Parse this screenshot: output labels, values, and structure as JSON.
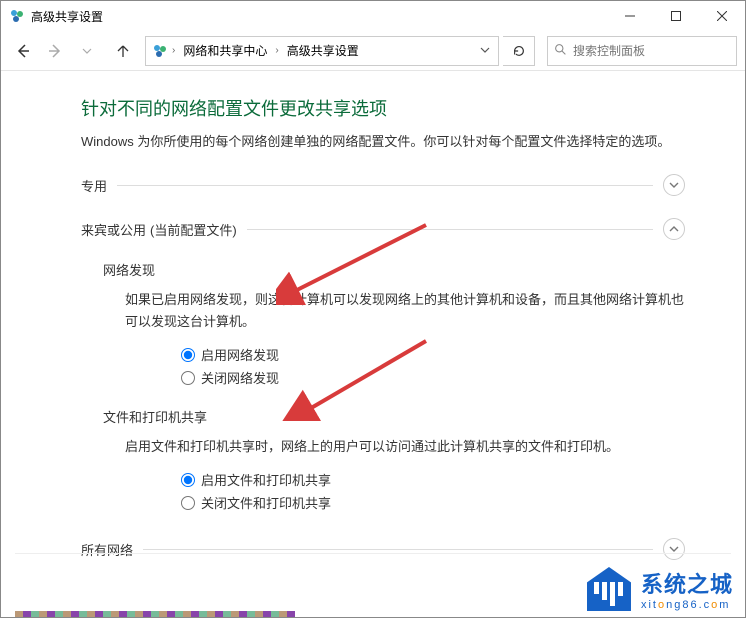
{
  "window": {
    "title": "高级共享设置"
  },
  "breadcrumb": {
    "seg1": "网络和共享中心",
    "seg2": "高级共享设置"
  },
  "search": {
    "placeholder": "搜索控制面板"
  },
  "page": {
    "title": "针对不同的网络配置文件更改共享选项",
    "desc": "Windows 为你所使用的每个网络创建单独的网络配置文件。你可以针对每个配置文件选择特定的选项。"
  },
  "sections": {
    "private": {
      "title": "专用"
    },
    "guest": {
      "title": "来宾或公用",
      "profile_suffix": "(当前配置文件)",
      "network_discovery": {
        "title": "网络发现",
        "desc": "如果已启用网络发现，则这台计算机可以发现网络上的其他计算机和设备，而且其他网络计算机也可以发现这台计算机。",
        "opt_on": "启用网络发现",
        "opt_off": "关闭网络发现"
      },
      "file_printer": {
        "title": "文件和打印机共享",
        "desc": "启用文件和打印机共享时，网络上的用户可以访问通过此计算机共享的文件和打印机。",
        "opt_on": "启用文件和打印机共享",
        "opt_off": "关闭文件和打印机共享"
      }
    },
    "all": {
      "title": "所有网络"
    }
  },
  "watermark": {
    "title": "系统之城",
    "sub_prefix": "xit",
    "sub_o": "o",
    "sub_mid": "ng86.c",
    "sub_o2": "o",
    "sub_end": "m"
  }
}
